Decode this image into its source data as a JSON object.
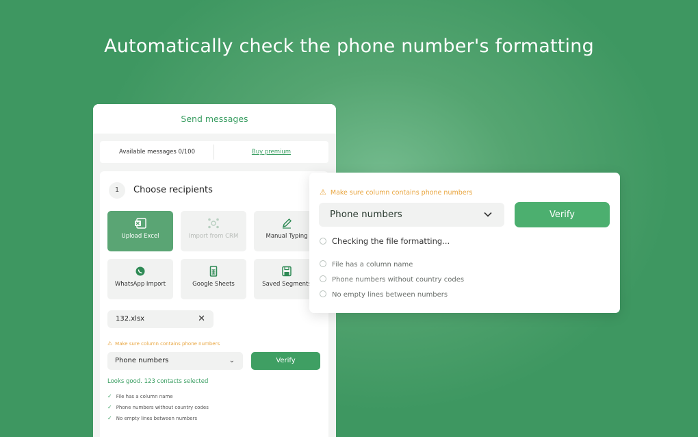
{
  "headline": "Automatically check the phone number's formatting",
  "panel": {
    "title": "Send messages",
    "available": "Available messages 0/100",
    "buy_premium": "Buy premium",
    "step": {
      "number": "1",
      "title": "Choose recipients"
    },
    "sources": [
      {
        "label": "Upload Excel",
        "icon": "excel-icon",
        "state": "active"
      },
      {
        "label": "Import from CRM",
        "icon": "crm-icon",
        "state": "disabled"
      },
      {
        "label": "Manual Typing",
        "icon": "pencil-icon",
        "state": "normal"
      },
      {
        "label": "WhatsApp Import",
        "icon": "whatsapp-icon",
        "state": "normal"
      },
      {
        "label": "Google Sheets",
        "icon": "sheets-icon",
        "state": "normal"
      },
      {
        "label": "Saved Segments",
        "icon": "save-icon",
        "state": "normal"
      }
    ],
    "file_name": "132.xlsx",
    "warning": "Make sure column contains phone numbers",
    "column_select": "Phone numbers",
    "verify_label": "Verify",
    "result": "Looks good. 123 contacts selected",
    "checks": [
      "File has a column name",
      "Phone numbers without country codes",
      "No empty lines between numbers"
    ]
  },
  "popup": {
    "warning": "Make sure column contains phone numbers",
    "column_select": "Phone numbers",
    "verify_label": "Verify",
    "status": "Checking the file formatting...",
    "checks": [
      "File has a column name",
      "Phone numbers without country codes",
      "No empty lines between numbers"
    ]
  },
  "colors": {
    "brand_green": "#3f9f63",
    "warning_orange": "#e8a43d"
  }
}
